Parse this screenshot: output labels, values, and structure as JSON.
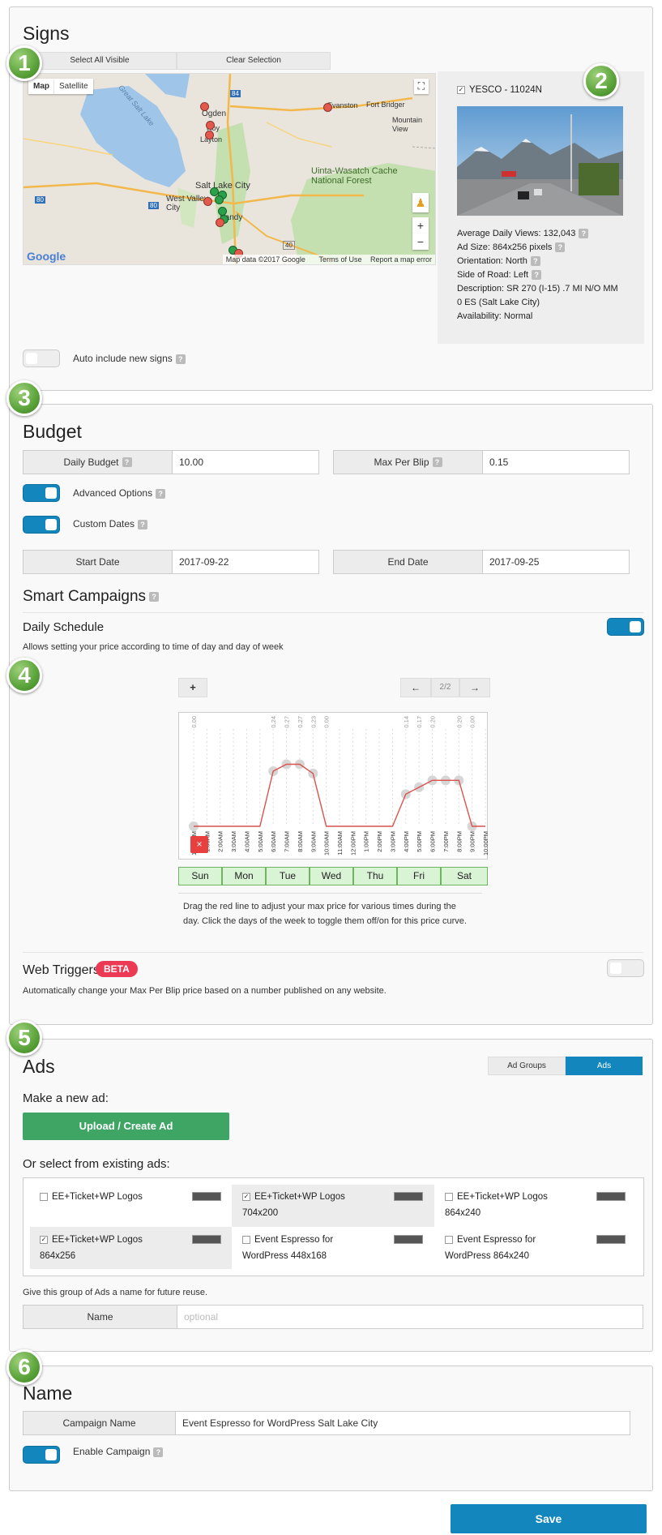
{
  "signs": {
    "title": "Signs",
    "select_all": "Select All Visible",
    "clear_selection": "Clear Selection",
    "map_btn": "Map",
    "satellite_btn": "Satellite",
    "map_labels": [
      "Great Salt Lake",
      "Ogden",
      "Roy",
      "Layton",
      "Salt Lake City",
      "West Valley City",
      "Sandy",
      "Evanston",
      "Fort Bridger",
      "Mountain View",
      "Uinta-Wasatch Cache National Forest",
      "80",
      "80",
      "84",
      "40"
    ],
    "map_data": "Map data ©2017 Google",
    "terms": "Terms of Use",
    "report": "Report a map error",
    "google": "Google",
    "auto_include": "Auto include new signs",
    "sign": {
      "name": "YESCO - 11024N",
      "views": "Average Daily Views: 132,043",
      "size": "Ad Size: 864x256 pixels",
      "orientation": "Orientation: North",
      "side": "Side of Road: Left",
      "desc1": "Description: SR 270 (I-15) .7 MI N/O MM",
      "desc2": "0 ES (Salt Lake City)",
      "availability": "Availability: Normal"
    }
  },
  "badges": [
    "1",
    "2",
    "3",
    "4",
    "5",
    "6"
  ],
  "budget": {
    "title": "Budget",
    "daily_label": "Daily Budget",
    "daily_value": "10.00",
    "max_label": "Max Per Blip",
    "max_value": "0.15",
    "advanced": "Advanced Options",
    "custom_dates": "Custom Dates",
    "start_label": "Start Date",
    "start_value": "2017-09-22",
    "end_label": "End Date",
    "end_value": "2017-09-25"
  },
  "smart": {
    "title": "Smart Campaigns",
    "daily_schedule": "Daily Schedule",
    "desc": "Allows setting your price according to time of day and day of week",
    "plus": "+",
    "prev": "←",
    "page": "2/2",
    "next": "→",
    "remove": "×",
    "days": [
      "Sun",
      "Mon",
      "Tue",
      "Wed",
      "Thu",
      "Fri",
      "Sat"
    ],
    "help1": "Drag the red line to adjust your max price for various times during the",
    "help2": "day. Click the days of the week to toggle them off/on for this price curve.",
    "web_triggers": "Web Triggers",
    "beta": "BETA",
    "web_desc": "Automatically change your Max Per Blip price based on a number published on any website."
  },
  "chart_data": {
    "type": "line",
    "x": [
      "12:00AM",
      "1:00AM",
      "2:00AM",
      "3:00AM",
      "4:00AM",
      "5:00AM",
      "6:00AM",
      "7:00AM",
      "8:00AM",
      "9:00AM",
      "10:00AM",
      "11:00AM",
      "12:00PM",
      "1:00PM",
      "2:00PM",
      "3:00PM",
      "4:00PM",
      "5:00PM",
      "6:00PM",
      "7:00PM",
      "8:00PM",
      "9:00PM",
      "10:00PM"
    ],
    "y": [
      0.0,
      0.0,
      0.0,
      0.0,
      0.0,
      0.0,
      0.24,
      0.27,
      0.27,
      0.23,
      0.0,
      0.0,
      0.0,
      0.0,
      0.0,
      0.0,
      0.14,
      0.17,
      0.2,
      0.2,
      0.2,
      0.0,
      0.0
    ],
    "labels": [
      "0.00",
      "",
      "",
      "",
      "",
      "",
      "0.24",
      "0.27",
      "0.27",
      "0.23",
      "0.00",
      "",
      "",
      "",
      "",
      "",
      "0.14",
      "0.17",
      "0.20",
      "",
      "0.20",
      "0.00",
      ""
    ],
    "ylim": [
      0,
      0.36
    ],
    "line_color": "#d9534f"
  },
  "ads": {
    "title": "Ads",
    "tab_groups": "Ad Groups",
    "tab_ads": "Ads",
    "make_new": "Make a new ad:",
    "upload": "Upload / Create Ad",
    "select_existing": "Or select from existing ads:",
    "items": [
      {
        "l1": "EE+Ticket+WP Logos",
        "l2": "",
        "checked": false
      },
      {
        "l1": "EE+Ticket+WP Logos",
        "l2": "704x200",
        "checked": true
      },
      {
        "l1": "EE+Ticket+WP Logos",
        "l2": "864x240",
        "checked": false
      },
      {
        "l1": "EE+Ticket+WP Logos",
        "l2": "864x256",
        "checked": true
      },
      {
        "l1": "Event Espresso for",
        "l2": "WordPress 448x168",
        "checked": false
      },
      {
        "l1": "Event Espresso for",
        "l2": "WordPress 864x240",
        "checked": false
      }
    ],
    "group_hint": "Give this group of Ads a name for future reuse.",
    "name_label": "Name",
    "name_placeholder": "optional"
  },
  "name_section": {
    "title": "Name",
    "campaign_label": "Campaign Name",
    "campaign_value": "Event Espresso for WordPress Salt Lake City",
    "enable": "Enable Campaign"
  },
  "save": "Save"
}
